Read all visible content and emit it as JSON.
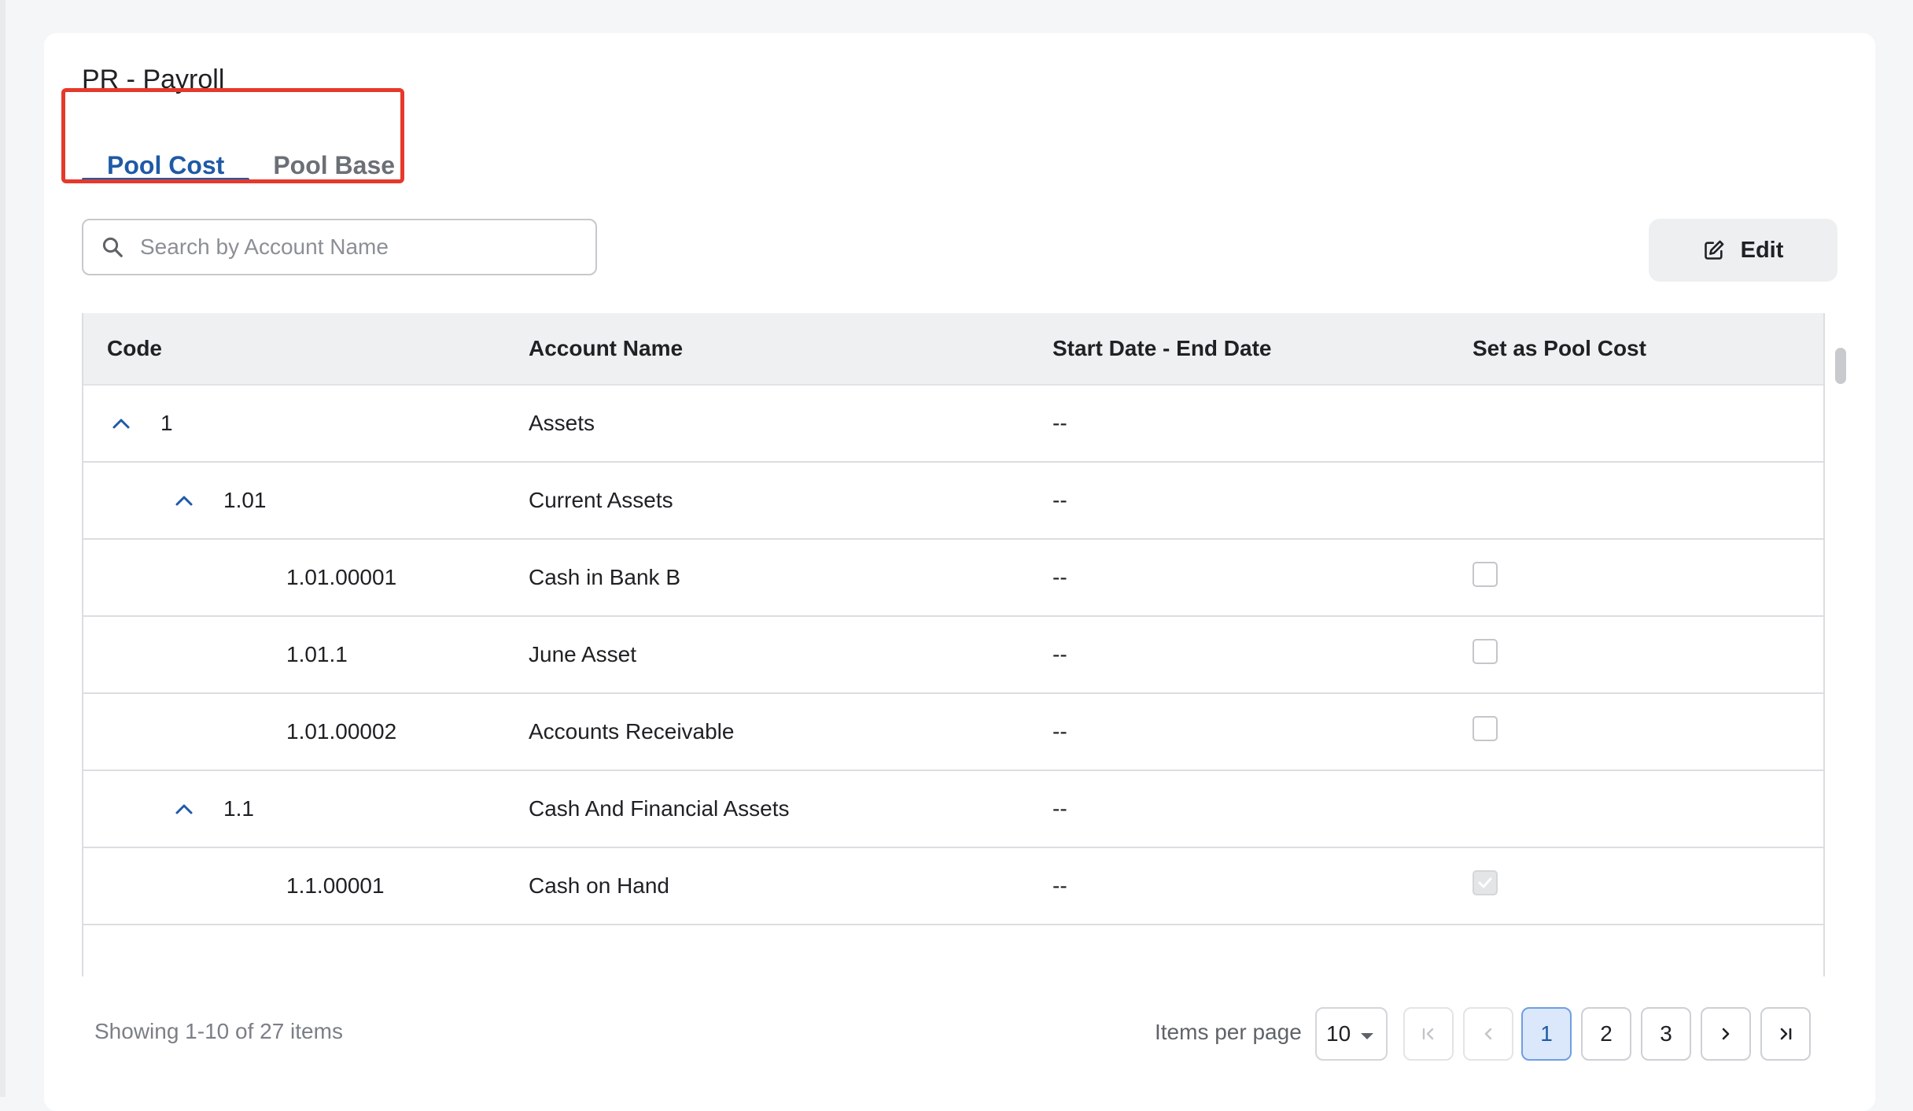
{
  "page": {
    "title": "PR - Payroll"
  },
  "tabs": [
    {
      "label": "Pool Cost",
      "active": true
    },
    {
      "label": "Pool Base",
      "active": false
    }
  ],
  "search": {
    "placeholder": "Search by Account Name",
    "value": ""
  },
  "toolbar": {
    "edit_label": "Edit"
  },
  "table": {
    "columns": [
      "Code",
      "Account Name",
      "Start Date - End Date",
      "Set as Pool Cost"
    ],
    "rows": [
      {
        "code": "1",
        "name": "Assets",
        "dates": "--",
        "expanded": true,
        "checkbox": "none"
      },
      {
        "code": "1.01",
        "name": "Current Assets",
        "dates": "--",
        "expanded": true,
        "checkbox": "none"
      },
      {
        "code": "1.01.00001",
        "name": "Cash in Bank B",
        "dates": "--",
        "checkbox": "unchecked"
      },
      {
        "code": "1.01.1",
        "name": "June Asset",
        "dates": "--",
        "checkbox": "unchecked"
      },
      {
        "code": "1.01.00002",
        "name": "Accounts Receivable",
        "dates": "--",
        "checkbox": "unchecked"
      },
      {
        "code": "1.1",
        "name": "Cash And Financial Assets",
        "dates": "--",
        "expanded": true,
        "checkbox": "none"
      },
      {
        "code": "1.1.00001",
        "name": "Cash on Hand",
        "dates": "--",
        "checkbox": "checked-disabled"
      }
    ]
  },
  "footer": {
    "status": "Showing 1-10 of 27 items",
    "items_per_page_label": "Items per page",
    "items_per_page_value": "10",
    "pages": [
      "1",
      "2",
      "3"
    ],
    "current_page": "1"
  },
  "icons": {
    "search": "search-icon",
    "edit": "edit-icon",
    "expand": "chevron-up-icon",
    "first": "first-page-icon",
    "prev": "chevron-left-icon",
    "next": "chevron-right-icon",
    "last": "last-page-icon",
    "caret": "caret-down-icon"
  },
  "colors": {
    "accent": "#1f5aa6",
    "highlight_box": "#e5392b",
    "header_bg": "#eff0f2"
  }
}
